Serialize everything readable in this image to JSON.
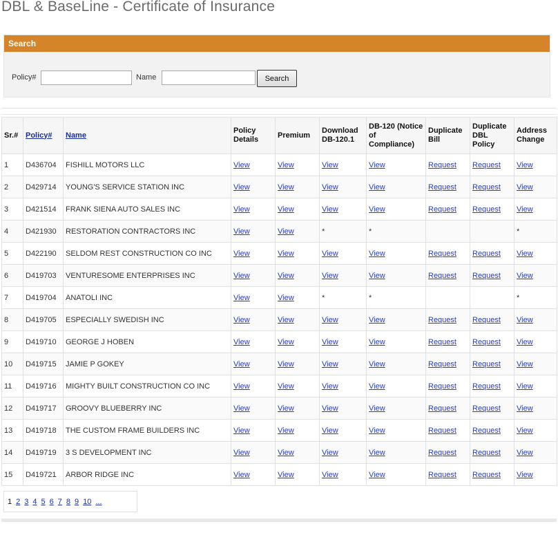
{
  "page": {
    "title": "DBL & BaseLine - Certificate of Insurance"
  },
  "search": {
    "header": "Search",
    "policy_label": "Policy#",
    "policy_value": "",
    "name_label": "Name",
    "name_value": "",
    "button_label": "Search"
  },
  "table": {
    "headers": {
      "sr": "Sr.#",
      "policy": "Policy#",
      "name": "Name",
      "policy_details": "Policy Details",
      "premium": "Premium",
      "download": "Download DB-120.1",
      "db120": "DB-120 (Notice of Compliance)",
      "dup_bill": "Duplicate Bill",
      "dup_dbl": "Duplicate DBL Policy",
      "address": "Address Change"
    },
    "rows": [
      {
        "sr": "1",
        "policy": "D436704",
        "name": "FISHILL MOTORS LLC",
        "details": "View",
        "premium": "View",
        "download": "View",
        "db120": "View",
        "dup_bill": "Request",
        "dup_dbl": "Request",
        "address": "View"
      },
      {
        "sr": "2",
        "policy": "D429714",
        "name": "YOUNG'S SERVICE STATION INC",
        "details": "View",
        "premium": "View",
        "download": "View",
        "db120": "View",
        "dup_bill": "Request",
        "dup_dbl": "Request",
        "address": "View"
      },
      {
        "sr": "3",
        "policy": "D421514",
        "name": "FRANK SIENA AUTO SALES INC",
        "details": "View",
        "premium": "View",
        "download": "View",
        "db120": "View",
        "dup_bill": "Request",
        "dup_dbl": "Request",
        "address": "View"
      },
      {
        "sr": "4",
        "policy": "D421930",
        "name": "RESTORATION CONTRACTORS INC",
        "details": "View",
        "premium": "View",
        "download": "*",
        "db120": "*",
        "dup_bill": "",
        "dup_dbl": "",
        "address": "*"
      },
      {
        "sr": "5",
        "policy": "D422190",
        "name": "SELDOM REST CONSTRUCTION CO INC",
        "details": "View",
        "premium": "View",
        "download": "View",
        "db120": "View",
        "dup_bill": "Request",
        "dup_dbl": "Request",
        "address": "View"
      },
      {
        "sr": "6",
        "policy": "D419703",
        "name": "VENTURESOME ENTERPRISES INC",
        "details": "View",
        "premium": "View",
        "download": "View",
        "db120": "View",
        "dup_bill": "Request",
        "dup_dbl": "Request",
        "address": "View"
      },
      {
        "sr": "7",
        "policy": "D419704",
        "name": "ANATOLI INC",
        "details": "View",
        "premium": "View",
        "download": "*",
        "db120": "*",
        "dup_bill": "",
        "dup_dbl": "",
        "address": "*"
      },
      {
        "sr": "8",
        "policy": "D419705",
        "name": "ESPECIALLY SWEDISH INC",
        "details": "View",
        "premium": "View",
        "download": "View",
        "db120": "View",
        "dup_bill": "Request",
        "dup_dbl": "Request",
        "address": "View"
      },
      {
        "sr": "9",
        "policy": "D419710",
        "name": "GEORGE J HOBEN",
        "details": "View",
        "premium": "View",
        "download": "View",
        "db120": "View",
        "dup_bill": "Request",
        "dup_dbl": "Request",
        "address": "View"
      },
      {
        "sr": "10",
        "policy": "D419715",
        "name": "JAMIE P GOKEY",
        "details": "View",
        "premium": "View",
        "download": "View",
        "db120": "View",
        "dup_bill": "Request",
        "dup_dbl": "Request",
        "address": "View"
      },
      {
        "sr": "11",
        "policy": "D419716",
        "name": "MIGHTY BUILT CONSTRUCTION CO INC",
        "details": "View",
        "premium": "View",
        "download": "View",
        "db120": "View",
        "dup_bill": "Request",
        "dup_dbl": "Request",
        "address": "View"
      },
      {
        "sr": "12",
        "policy": "D419717",
        "name": "GROOVY BLUEBERRY INC",
        "details": "View",
        "premium": "View",
        "download": "View",
        "db120": "View",
        "dup_bill": "Request",
        "dup_dbl": "Request",
        "address": "View"
      },
      {
        "sr": "13",
        "policy": "D419718",
        "name": "THE CUSTOM FRAME BUILDERS INC",
        "details": "View",
        "premium": "View",
        "download": "View",
        "db120": "View",
        "dup_bill": "Request",
        "dup_dbl": "Request",
        "address": "View"
      },
      {
        "sr": "14",
        "policy": "D419719",
        "name": "3 S DEVELOPMENT INC",
        "details": "View",
        "premium": "View",
        "download": "View",
        "db120": "View",
        "dup_bill": "Request",
        "dup_dbl": "Request",
        "address": "View"
      },
      {
        "sr": "15",
        "policy": "D419721",
        "name": "ARBOR RIDGE INC",
        "details": "View",
        "premium": "View",
        "download": "View",
        "db120": "View",
        "dup_bill": "Request",
        "dup_dbl": "Request",
        "address": "View"
      }
    ]
  },
  "pager": {
    "current": "1",
    "pages": [
      "2",
      "3",
      "4",
      "5",
      "6",
      "7",
      "8",
      "9",
      "10",
      "..."
    ]
  }
}
